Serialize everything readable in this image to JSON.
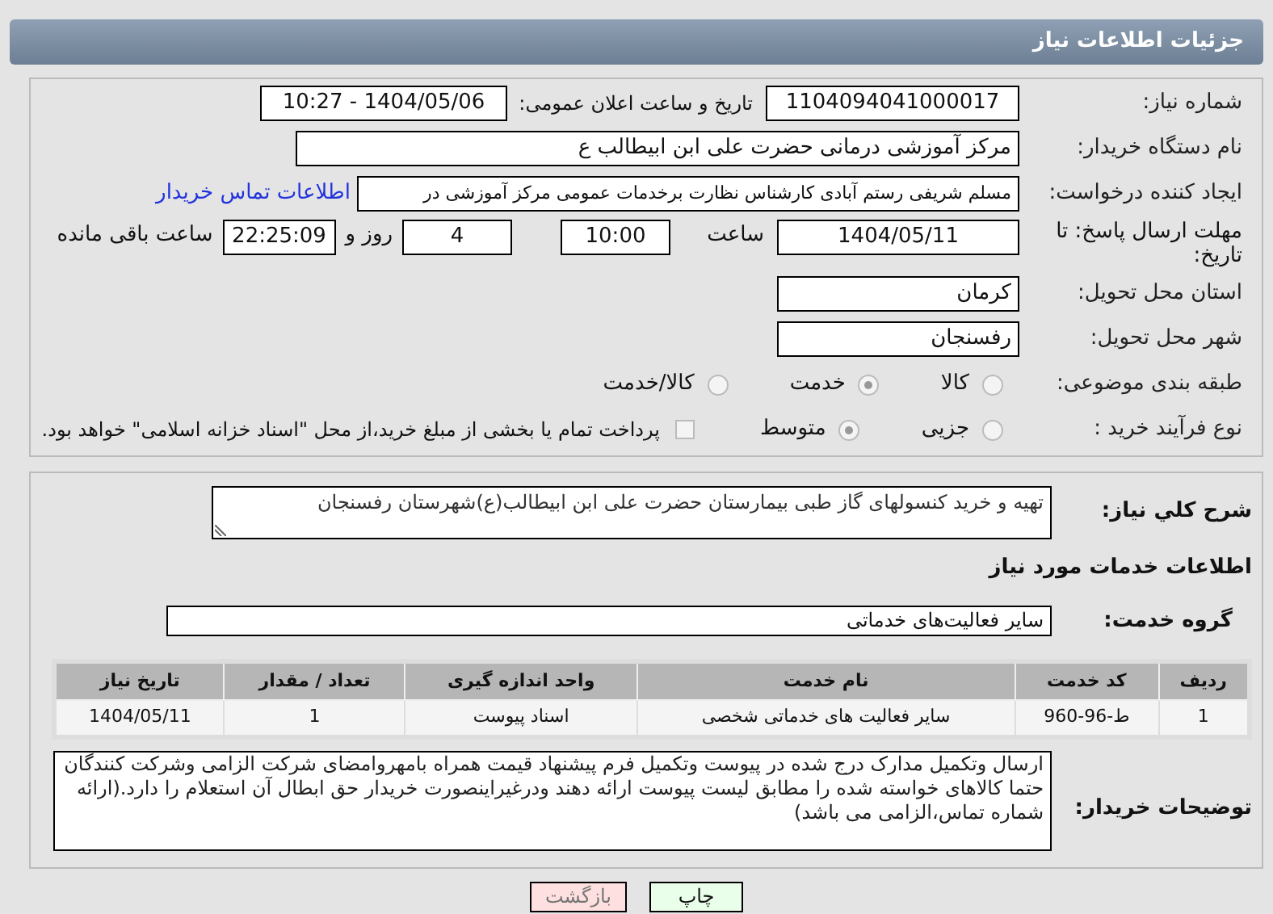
{
  "header": {
    "title": "جزئیات اطلاعات نیاز"
  },
  "need_number": {
    "label": "شماره نیاز:",
    "value": "1104094041000017"
  },
  "announce": {
    "label": "تاریخ و ساعت اعلان عمومی:",
    "value": "1404/05/06 - 10:27"
  },
  "buyer": {
    "label": "نام دستگاه خریدار:",
    "value": "مرکز آموزشی  درمانی حضرت علی ابن ابیطالب ع"
  },
  "requester": {
    "label": "ایجاد کننده درخواست:",
    "value": "مسلم شریفی رستم آبادی کارشناس نظارت برخدمات عمومی مرکز آموزشی  در",
    "link": "اطلاعات تماس خریدار"
  },
  "deadline": {
    "label": "مهلت ارسال پاسخ: تا تاریخ:",
    "date": "1404/05/11",
    "time_label": "ساعت",
    "time": "10:00",
    "days": "4",
    "days_label": "روز و",
    "remaining": "22:25:09",
    "remaining_label": "ساعت باقی مانده"
  },
  "province": {
    "label": "استان محل تحویل:",
    "value": "کرمان"
  },
  "city": {
    "label": "شهر محل تحویل:",
    "value": "رفسنجان"
  },
  "category": {
    "label": "طبقه بندی موضوعی:",
    "options": [
      {
        "label": "کالا",
        "selected": false
      },
      {
        "label": "خدمت",
        "selected": true
      },
      {
        "label": "کالا/خدمت",
        "selected": false
      }
    ]
  },
  "purchase_type": {
    "label": "نوع فرآیند خرید :",
    "options": [
      {
        "label": "جزیی",
        "selected": false
      },
      {
        "label": "متوسط",
        "selected": true
      }
    ],
    "payment": {
      "checked": false,
      "text": "پرداخت تمام یا بخشی از مبلغ خرید،از محل \"اسناد خزانه اسلامی\" خواهد بود."
    }
  },
  "summary": {
    "label": "شرح کلي نياز:",
    "value": "تهیه و خرید کنسولهای گاز طبی بیمارستان حضرت علی ابن ابیطالب(ع)شهرستان رفسنجان"
  },
  "services_title": "اطلاعات خدمات مورد نیاز",
  "service_group": {
    "label": "گروه خدمت:",
    "value": "سایر فعالیت‌های خدماتی"
  },
  "table": {
    "columns": [
      "ردیف",
      "کد خدمت",
      "نام خدمت",
      "واحد اندازه گیری",
      "تعداد / مقدار",
      "تاریخ نیاز"
    ],
    "rows": [
      [
        "1",
        "ط-96-960",
        "سایر فعالیت های خدماتی شخصی",
        "اسناد پیوست",
        "1",
        "1404/05/11"
      ]
    ]
  },
  "notes": {
    "label": "توضیحات خریدار:",
    "value": "ارسال وتکمیل مدارک درج شده در پیوست وتکمیل فرم پیشنهاد قیمت همراه بامهروامضای شرکت الزامی وشرکت کنندگان حتما کالاهای خواسته شده را مطابق لیست پیوست ارائه دهند ودرغیراینصورت خریدار حق ابطال آن استعلام را دارد.(ارائه شماره تماس،الزامی می باشد)"
  },
  "buttons": [
    {
      "kind": "print",
      "label": "چاپ"
    },
    {
      "kind": "back",
      "label": "بازگشت"
    }
  ]
}
